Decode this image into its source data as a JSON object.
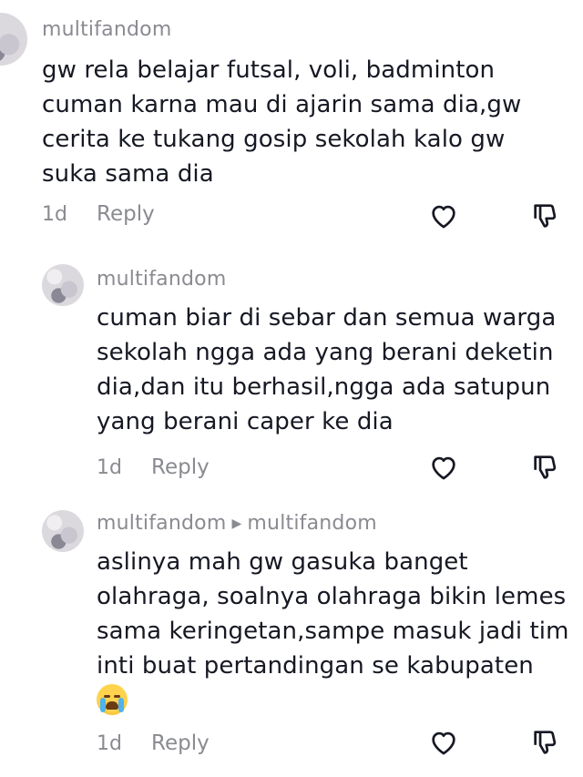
{
  "comments": [
    {
      "username": "multifandom",
      "text": "gw rela belajar futsal, voli, badminton\ncuman karna mau di ajarin sama dia,gw\ncerita ke tukang gosip sekolah kalo gw\nsuka sama dia",
      "time": "1d",
      "reply_label": "Reply"
    },
    {
      "username": "multifandom",
      "text": "cuman biar di sebar dan semua warga\nsekolah ngga ada yang berani deketin\ndia,dan itu berhasil,ngga ada satupun\nyang berani caper ke dia",
      "time": "1d",
      "reply_label": "Reply"
    },
    {
      "username": "multifandom",
      "reply_to": "multifandom",
      "text": "aslinya mah gw gasuka banget\nolahraga, soalnya olahraga bikin lemes\nsama keringetan,sampe masuk jadi tim\ninti buat pertandingan se kabupaten",
      "emoji": "loudly-crying-face-emoji",
      "time": "1d",
      "reply_label": "Reply"
    }
  ],
  "icons": {
    "like": "heart-outline-icon",
    "dislike": "thumbs-down-icon",
    "reply_arrow": "triangle-right-icon"
  },
  "colors": {
    "text": "#161823",
    "secondary": "#8a8b91",
    "background": "#ffffff"
  }
}
